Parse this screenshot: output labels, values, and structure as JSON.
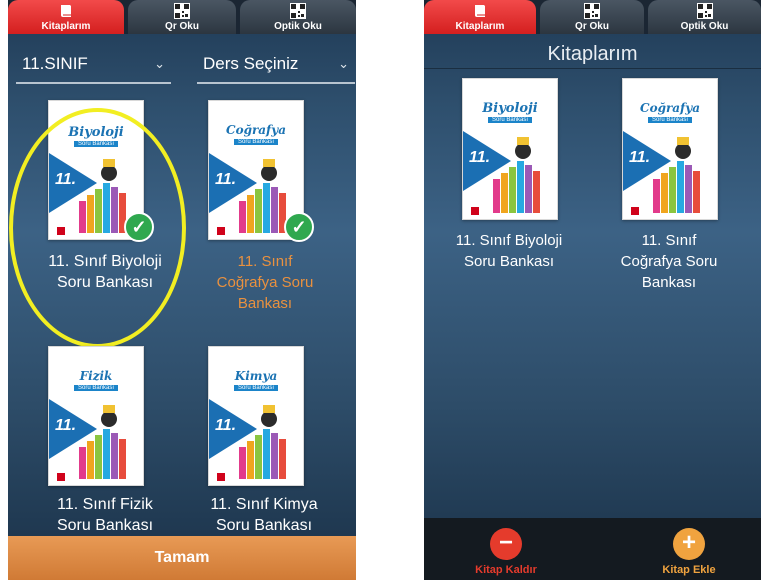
{
  "left_screen": {
    "tabs": [
      {
        "label": "Kitaplarım",
        "icon": "book-icon",
        "active": true
      },
      {
        "label": "Qr Oku",
        "icon": "qr-code-icon",
        "active": false
      },
      {
        "label": "Optik Oku",
        "icon": "qr-code-icon",
        "active": false
      }
    ],
    "class_select": {
      "value": "11.SINIF"
    },
    "subject_select": {
      "value": "Ders Seçiniz"
    },
    "books": [
      {
        "title": "Biyoloji",
        "subtitle": "Soru Bankası",
        "grade": "11.",
        "label_line1": "11. Sınıf Biyoloji",
        "label_line2": "Soru Bankası",
        "label_line3": "",
        "selected": true
      },
      {
        "title": "Coğrafya",
        "subtitle": "Soru Bankası",
        "grade": "11.",
        "label_line1": "11. Sınıf",
        "label_line2": "Coğrafya Soru",
        "label_line3": "Bankası",
        "selected": true
      },
      {
        "title": "Fizik",
        "subtitle": "Soru Bankası",
        "grade": "11.",
        "label_line1": "11. Sınıf Fizik",
        "label_line2": "Soru Bankası",
        "label_line3": "",
        "selected": false
      },
      {
        "title": "Kimya",
        "subtitle": "Soru Bankası",
        "grade": "11.",
        "label_line1": "11. Sınıf Kimya",
        "label_line2": "Soru Bankası",
        "label_line3": "",
        "selected": false
      }
    ],
    "done_button": "Tamam"
  },
  "right_screen": {
    "tabs": [
      {
        "label": "Kitaplarım",
        "icon": "book-icon",
        "active": true
      },
      {
        "label": "Qr Oku",
        "icon": "qr-code-icon",
        "active": false
      },
      {
        "label": "Optik Oku",
        "icon": "qr-code-icon",
        "active": false
      }
    ],
    "title": "Kitaplarım",
    "books": [
      {
        "title": "Biyoloji",
        "subtitle": "Soru Bankası",
        "grade": "11.",
        "label_line1": "11. Sınıf Biyoloji",
        "label_line2": "Soru Bankası",
        "label_line3": ""
      },
      {
        "title": "Coğrafya",
        "subtitle": "Soru Bankası",
        "grade": "11.",
        "label_line1": "11. Sınıf",
        "label_line2": "Coğrafya Soru",
        "label_line3": "Bankası"
      }
    ],
    "remove_button": "Kitap Kaldır",
    "add_button": "Kitap Ekle"
  },
  "colors": {
    "active_tab": "#e02626",
    "selected_check": "#2fa84f",
    "done_bar": "#e08a45",
    "remove": "#e53b2c",
    "add": "#f0a33f",
    "highlight": "#f2ee22"
  }
}
